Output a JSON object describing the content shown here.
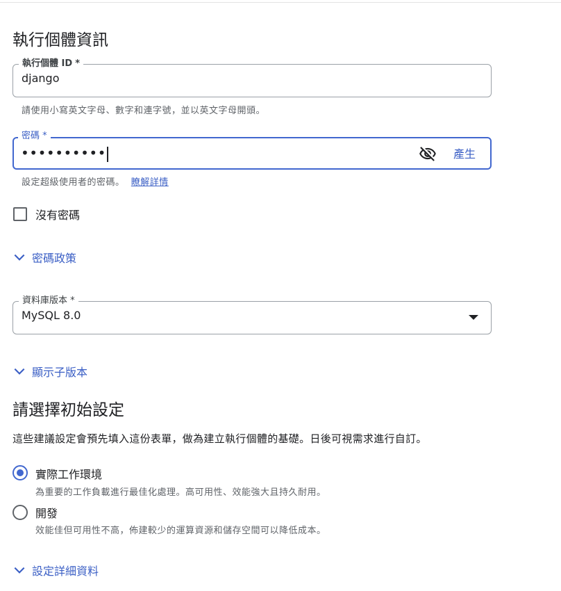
{
  "section_instance": {
    "title": "執行個體資訊",
    "instance_id": {
      "label": "執行個體 ID",
      "required_mark": "*",
      "value": "django",
      "hint": "請使用小寫英文字母、數字和連字號，並以英文字母開頭。"
    },
    "password": {
      "label": "密碼",
      "required_mark": "*",
      "value": "••••••••••",
      "visibility_icon": "eye-off-icon",
      "generate_label": "產生",
      "hint": "設定超級使用者的密碼。",
      "learn_more": "瞭解詳情"
    },
    "no_password": {
      "label": "沒有密碼",
      "checked": false
    },
    "password_policy": {
      "label": "密碼政策",
      "icon": "chevron-down-icon"
    },
    "db_version": {
      "label": "資料庫版本",
      "required_mark": "*",
      "value": "MySQL 8.0"
    },
    "show_minor": {
      "label": "顯示子版本",
      "icon": "chevron-down-icon"
    }
  },
  "section_config": {
    "title": "請選擇初始設定",
    "description": "這些建議設定會預先填入這份表單，做為建立執行個體的基礎。日後可視需求進行自訂。",
    "options": [
      {
        "label": "實際工作環境",
        "sub": "為重要的工作負載進行最佳化處理。高可用性、效能強大且持久耐用。",
        "selected": true
      },
      {
        "label": "開發",
        "sub": "效能佳但可用性不高，佈建較少的運算資源和儲存空間可以降低成本。",
        "selected": false
      }
    ],
    "details": {
      "label": "設定詳細資料",
      "icon": "chevron-down-icon"
    }
  },
  "colors": {
    "accent": "#4167cf",
    "link": "#3b5fc5",
    "border": "#9aa0a6",
    "hint": "#5f6368"
  }
}
